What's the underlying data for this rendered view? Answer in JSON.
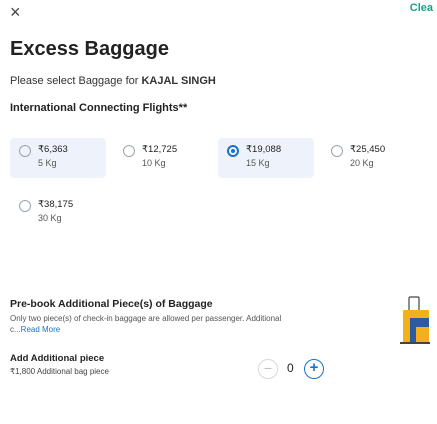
{
  "header": {
    "close_glyph": "×",
    "clear_label": "Clea"
  },
  "title": "Excess Baggage",
  "subtitle_prefix": "Please select Baggage for ",
  "passenger_name": "KAJAL SINGH",
  "section_title": "International Connecting Flights**",
  "options": [
    {
      "price": "₹6,363",
      "weight": "5 Kg",
      "selected": false
    },
    {
      "price": "₹12,725",
      "weight": "10 Kg",
      "selected": false
    },
    {
      "price": "₹19,088",
      "weight": "15 Kg",
      "selected": true
    },
    {
      "price": "₹25,450",
      "weight": "20 Kg",
      "selected": false
    },
    {
      "price": "₹38,175",
      "weight": "30 Kg",
      "selected": false
    }
  ],
  "prebook": {
    "title": "Pre-book Additional Piece(s) of Baggage",
    "description": "Only two piece(s) of check-in baggage are allowed per passenger. Additional c...",
    "read_more": "Read More",
    "add_title": "Add Additional piece",
    "add_price": "₹1,800 Additional bag piece",
    "quantity": "0",
    "minus_glyph": "−",
    "plus_glyph": "+"
  },
  "colors": {
    "accent": "#1a73c8",
    "clear_link": "#16a08a",
    "selected_bg": "#eef3fb",
    "bag_yellow": "#f2b01e"
  },
  "icons": {
    "close": "close-icon",
    "bag": "luggage-icon"
  }
}
